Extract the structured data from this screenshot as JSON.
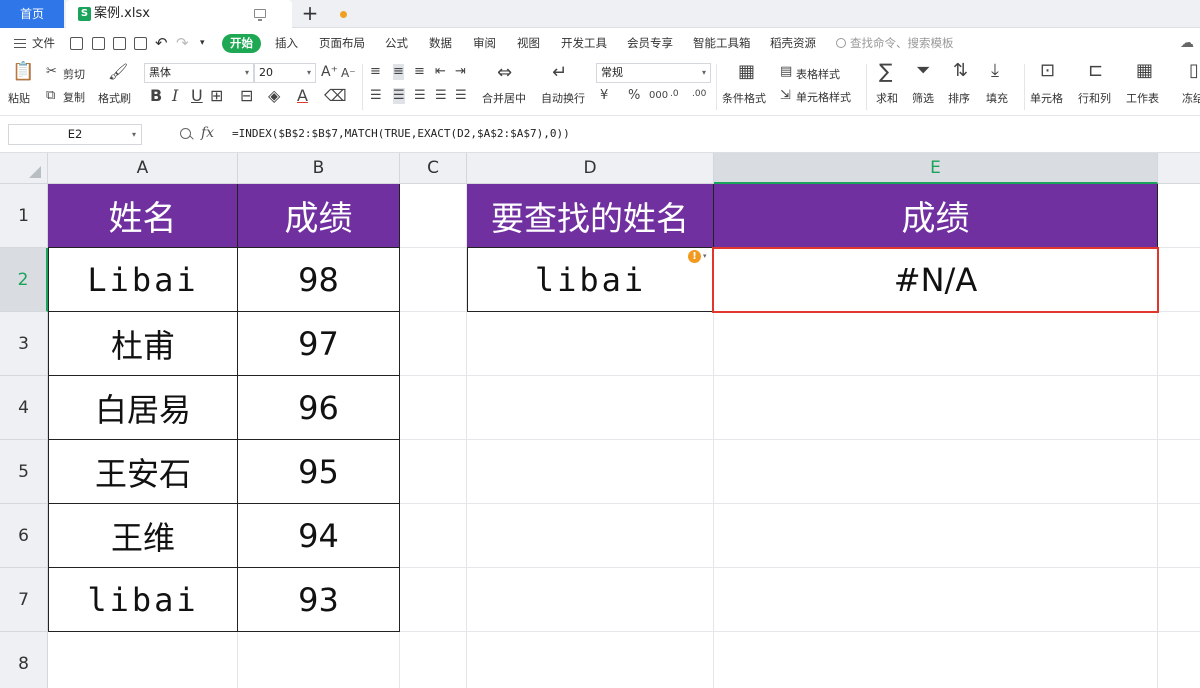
{
  "tabs": {
    "home": "首页",
    "file": "案例.xlsx",
    "file_icon": "S"
  },
  "menu": {
    "file": "文件",
    "active": "开始",
    "items": [
      "插入",
      "页面布局",
      "公式",
      "数据",
      "审阅",
      "视图",
      "开发工具",
      "会员专享",
      "智能工具箱",
      "稻壳资源"
    ],
    "search_placeholder": "查找命令、搜索模板"
  },
  "ribbon": {
    "paste": "粘贴",
    "cut": "剪切",
    "copy": "复制",
    "format_painter": "格式刷",
    "font_name": "黑体",
    "font_size": "20",
    "merge_center": "合并居中",
    "wrap_text": "自动换行",
    "number_format": "常规",
    "conditional_format": "条件格式",
    "table_style": "表格样式",
    "cell_style": "单元格样式",
    "sum": "求和",
    "filter": "筛选",
    "sort": "排序",
    "fill": "填充",
    "cell": "单元格",
    "row_col": "行和列",
    "worksheet": "工作表",
    "freeze": "冻结"
  },
  "formula_bar": {
    "name_box": "E2",
    "fx": "fx",
    "formula": "=INDEX($B$2:$B$7,MATCH(TRUE,EXACT(D2,$A$2:$A$7),0))"
  },
  "columns": [
    "A",
    "B",
    "C",
    "D",
    "E"
  ],
  "rows": [
    "1",
    "2",
    "3",
    "4",
    "5",
    "6",
    "7",
    "8"
  ],
  "table": {
    "headers": [
      "姓名",
      "成绩"
    ],
    "data": [
      [
        "Libai",
        "98"
      ],
      [
        "杜甫",
        "97"
      ],
      [
        "白居易",
        "96"
      ],
      [
        "王安石",
        "95"
      ],
      [
        "王维",
        "94"
      ],
      [
        "libai",
        "93"
      ]
    ]
  },
  "lookup": {
    "headers": [
      "要查找的姓名",
      "成绩"
    ],
    "name": "libai",
    "result": "#N/A",
    "warning_icon": "!"
  },
  "colors": {
    "header_fill": "#7030a0",
    "accent": "#1aa35a",
    "selection_border": "#e0362c"
  }
}
